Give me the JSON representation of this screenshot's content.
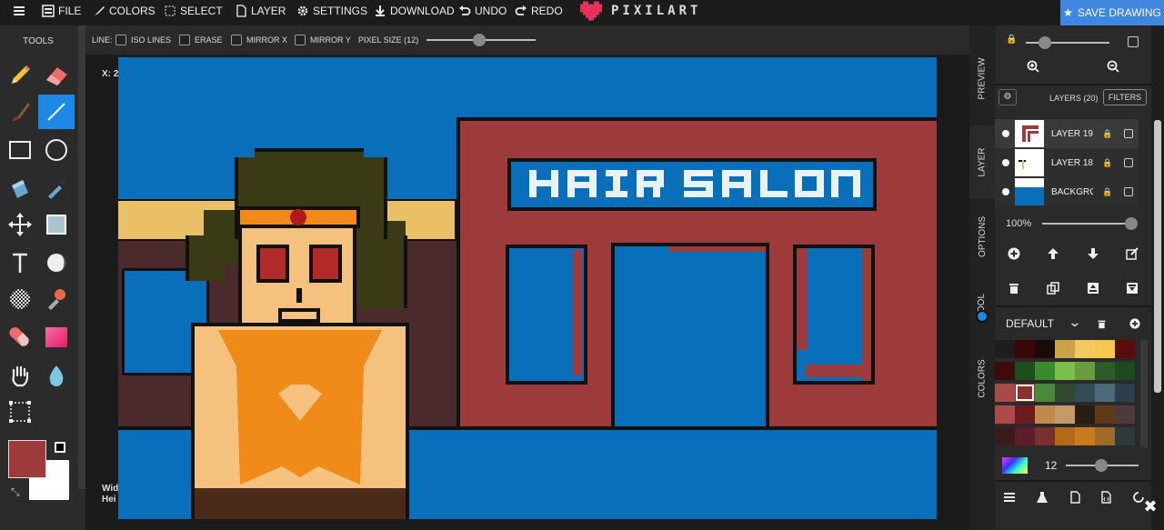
{
  "topbar": {
    "menu_icon": "hamburger-icon",
    "file": "FILE",
    "colors": "COLORS",
    "select": "SELECT",
    "layer": "LAYER",
    "settings": "SETTINGS",
    "download": "DOWNLOAD",
    "undo": "UNDO",
    "redo": "REDO",
    "logo": "PIXILART",
    "save": "SAVE DRAWING"
  },
  "tools": {
    "title": "TOOLS",
    "items": [
      "pencil",
      "eraser",
      "brush",
      "line",
      "rectangle",
      "circle",
      "bucket",
      "eyedropper",
      "move",
      "fill-square",
      "text",
      "sphere",
      "dither",
      "stamp",
      "shape-eraser",
      "gradient",
      "hand",
      "droplet",
      "select"
    ]
  },
  "options": {
    "line_label": "LINE:",
    "iso_lines": "ISO LINES",
    "erase": "ERASE",
    "mirror_x": "MIRROR X",
    "mirror_y": "MIRROR Y",
    "pixel_size": "PIXEL SIZE (12)",
    "pixel_size_value": 12
  },
  "stage": {
    "x_coord": "X: 2",
    "w_label": "Wid",
    "h_label": "Hei"
  },
  "sidetabs": [
    "PREVIEW",
    "LAYER",
    "OPTIONS",
    "TOOL",
    "COLORS"
  ],
  "layers_panel": {
    "title": "LAYERS (20)",
    "filters": "FILTERS",
    "opacity": "100%",
    "rows": [
      {
        "name": "LAYER 19"
      },
      {
        "name": "LAYER 18"
      },
      {
        "name": "BACKGROUND"
      }
    ]
  },
  "palette_panel": {
    "name": "DEFAULT",
    "brush_size": "12",
    "colors": [
      [
        "#1e1e1e",
        "#3a0606",
        "#1b0a0a",
        "#c9a249",
        "#f2c862",
        "#f5c74f",
        "#5a0c0c"
      ],
      [
        "#3f0a0a",
        "#1e4d1e",
        "#3a8a30",
        "#7bbf4a",
        "#6b9a42",
        "#2f5a2a",
        "#1f4a1f"
      ],
      [
        "#a94a4a",
        "#8b2f2f",
        "#49893a",
        "#2f4a2f",
        "#324b54",
        "#4d6a7a",
        "#2d3f4a"
      ],
      [
        "#b04a4a",
        "#6a1c1c",
        "#c08a4a",
        "#c59a6a",
        "#2a1e12",
        "#5e3a18",
        "#4f3a3a"
      ],
      [
        "#3a1c1c",
        "#5b1e2a",
        "#7a2f2f",
        "#b06a1a",
        "#c97a1a",
        "#9e6a2a",
        "#2e3a3a"
      ]
    ]
  },
  "primary_color": "#9e3a3a",
  "secondary_color": "#ffffff",
  "scene": {
    "sign_text": "HAIR SALON",
    "sky": "#0a6fbb",
    "building": "#9c3a3c",
    "awning": "#e9c066",
    "skin": "#f4c27e",
    "outfit": "#f08a19",
    "hair": "#3a3a16",
    "eyes": "#b22a2a"
  }
}
